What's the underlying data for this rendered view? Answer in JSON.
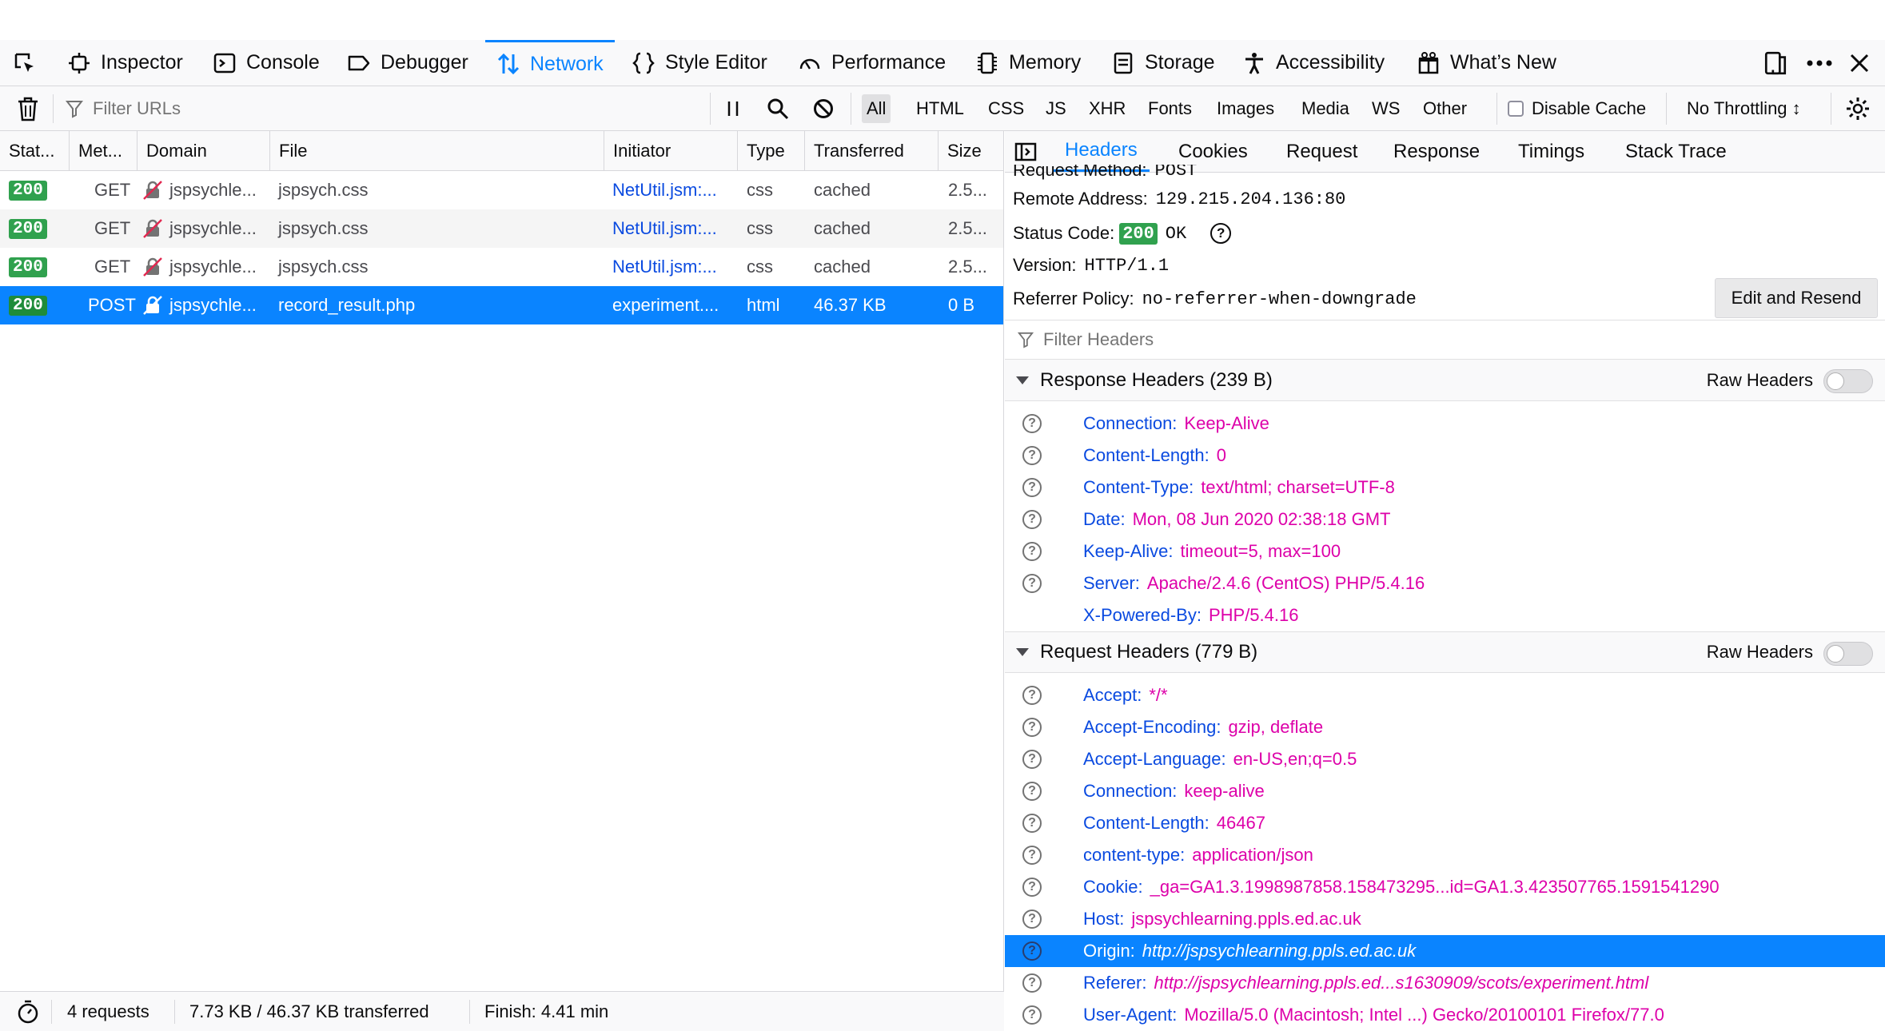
{
  "toolbox": {
    "tabs": [
      {
        "label": "Inspector"
      },
      {
        "label": "Console"
      },
      {
        "label": "Debugger"
      },
      {
        "label": "Network"
      },
      {
        "label": "Style Editor"
      },
      {
        "label": "Performance"
      },
      {
        "label": "Memory"
      },
      {
        "label": "Storage"
      },
      {
        "label": "Accessibility"
      },
      {
        "label": "What’s New"
      }
    ]
  },
  "toolbar": {
    "filter_placeholder": "Filter URLs",
    "types": [
      "All",
      "HTML",
      "CSS",
      "JS",
      "XHR",
      "Fonts",
      "Images",
      "Media",
      "WS",
      "Other"
    ],
    "disable_cache": "Disable Cache",
    "throttling": "No Throttling ↕"
  },
  "table": {
    "columns": [
      "Stat...",
      "Met...",
      "Domain",
      "File",
      "Initiator",
      "Type",
      "Transferred",
      "Size"
    ],
    "rows": [
      {
        "status": "200",
        "method": "GET",
        "domain": "jspsychle...",
        "file": "jspsych.css",
        "initiator": "NetUtil.jsm:...",
        "type": "css",
        "transferred": "cached",
        "size": "2.5..."
      },
      {
        "status": "200",
        "method": "GET",
        "domain": "jspsychle...",
        "file": "jspsych.css",
        "initiator": "NetUtil.jsm:...",
        "type": "css",
        "transferred": "cached",
        "size": "2.5..."
      },
      {
        "status": "200",
        "method": "GET",
        "domain": "jspsychle...",
        "file": "jspsych.css",
        "initiator": "NetUtil.jsm:...",
        "type": "css",
        "transferred": "cached",
        "size": "2.5..."
      },
      {
        "status": "200",
        "method": "POST",
        "domain": "jspsychle...",
        "file": "record_result.php",
        "initiator": "experiment....",
        "type": "html",
        "transferred": "46.37 KB",
        "size": "0 B"
      }
    ]
  },
  "statusbar": {
    "requests": "4 requests",
    "transferred": "7.73 KB / 46.37 KB transferred",
    "finish": "Finish: 4.41 min"
  },
  "details": {
    "tabs": [
      "Headers",
      "Cookies",
      "Request",
      "Response",
      "Timings",
      "Stack Trace"
    ],
    "summary": {
      "request_method_label": "Request Method:",
      "request_method": "POST",
      "remote_address_label": "Remote Address:",
      "remote_address": "129.215.204.136:80",
      "status_code_label": "Status Code:",
      "status_code": "200",
      "status_text": "OK",
      "version_label": "Version:",
      "version": "HTTP/1.1",
      "referrer_policy_label": "Referrer Policy:",
      "referrer_policy": "no-referrer-when-downgrade"
    },
    "edit_resend": "Edit and Resend",
    "filter_headers_placeholder": "Filter Headers",
    "raw_headers_label": "Raw Headers",
    "response_title": "Response Headers (239 B)",
    "response_headers": [
      {
        "name": "Connection:",
        "value": "Keep-Alive"
      },
      {
        "name": "Content-Length:",
        "value": "0"
      },
      {
        "name": "Content-Type:",
        "value": "text/html; charset=UTF-8"
      },
      {
        "name": "Date:",
        "value": "Mon, 08 Jun 2020 02:38:18 GMT"
      },
      {
        "name": "Keep-Alive:",
        "value": "timeout=5, max=100"
      },
      {
        "name": "Server:",
        "value": "Apache/2.4.6 (CentOS) PHP/5.4.16"
      },
      {
        "name": "X-Powered-By:",
        "value": "PHP/5.4.16"
      }
    ],
    "request_title": "Request Headers (779 B)",
    "request_headers": [
      {
        "name": "Accept:",
        "value": "*/*"
      },
      {
        "name": "Accept-Encoding:",
        "value": "gzip, deflate"
      },
      {
        "name": "Accept-Language:",
        "value": "en-US,en;q=0.5"
      },
      {
        "name": "Connection:",
        "value": "keep-alive"
      },
      {
        "name": "Content-Length:",
        "value": "46467"
      },
      {
        "name": "content-type:",
        "value": "application/json"
      },
      {
        "name": "Cookie:",
        "value": "_ga=GA1.3.1998987858.158473295...id=GA1.3.423507765.1591541290"
      },
      {
        "name": "Host:",
        "value": "jspsychlearning.ppls.ed.ac.uk"
      },
      {
        "name": "Origin:",
        "value": "http://jspsychlearning.ppls.ed.ac.uk"
      },
      {
        "name": "Referer:",
        "value": "http://jspsychlearning.ppls.ed...s1630909/scots/experiment.html"
      },
      {
        "name": "User-Agent:",
        "value": "Mozilla/5.0 (Macintosh; Intel ...) Gecko/20100101 Firefox/77.0"
      }
    ]
  },
  "colors": {
    "accent": "#0a84ff",
    "status_ok": "#30a14e",
    "header_name": "#0a4ae0",
    "header_value": "#dd00a9"
  }
}
